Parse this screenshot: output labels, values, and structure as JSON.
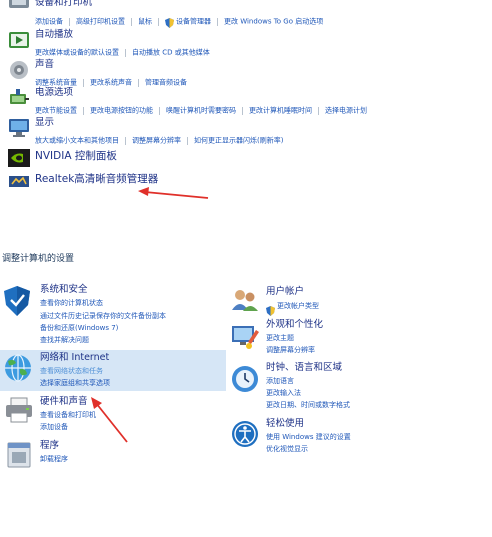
{
  "top": {
    "devices": {
      "title": "设备和打印机",
      "links": [
        "添加设备",
        "高级打印机设置",
        "鼠标",
        "设备管理器",
        "更改 Windows To Go 启动选项"
      ]
    },
    "autoplay": {
      "title": "自动播放",
      "links": [
        "更改媒体或设备的默认设置",
        "自动播放 CD 或其他媒体"
      ]
    },
    "sound": {
      "title": "声音",
      "links": [
        "调整系统音量",
        "更改系统声音",
        "管理音频设备"
      ]
    },
    "power": {
      "title": "电源选项",
      "links": [
        "更改节能设置",
        "更改电源按钮的功能",
        "唤醒计算机时需要密码",
        "更改计算机睡眠时间",
        "选择电源计划"
      ]
    },
    "display": {
      "title": "显示",
      "links": [
        "放大或缩小文本和其他项目",
        "调整屏幕分辨率",
        "如何更正显示器闪烁(刷新率)"
      ]
    },
    "nvidia": {
      "title": "NVIDIA 控制面板"
    },
    "realtek": {
      "title": "Realtek高清晰音频管理器"
    }
  },
  "section_heading": "调整计算机的设置",
  "left": {
    "security": {
      "title": "系统和安全",
      "links": [
        "查看你的计算机状态",
        "通过文件历史记录保存你的文件备份副本",
        "备份和还原(Windows 7)",
        "查找并解决问题"
      ]
    },
    "network": {
      "title": "网络和 Internet",
      "links": [
        "查看网络状态和任务",
        "选择家庭组和共享选项"
      ]
    },
    "hardware": {
      "title": "硬件和声音",
      "links": [
        "查看设备和打印机",
        "添加设备"
      ]
    },
    "programs": {
      "title": "程序",
      "links": [
        "卸载程序"
      ]
    }
  },
  "right": {
    "accounts": {
      "title": "用户帐户",
      "links": [
        "更改帐户类型"
      ]
    },
    "appearance": {
      "title": "外观和个性化",
      "links": [
        "更改主题",
        "调整屏幕分辨率"
      ]
    },
    "clock": {
      "title": "时钟、语言和区域",
      "links": [
        "添加语言",
        "更改输入法",
        "更改日期、时间或数字格式"
      ]
    },
    "ease": {
      "title": "轻松使用",
      "links": [
        "使用 Windows 建议的设置",
        "优化视觉显示"
      ]
    }
  },
  "colors": {
    "title": "#1e3287",
    "link": "#1f57b8",
    "highlight": "#d6e6f6",
    "arrow": "#e0302a"
  }
}
